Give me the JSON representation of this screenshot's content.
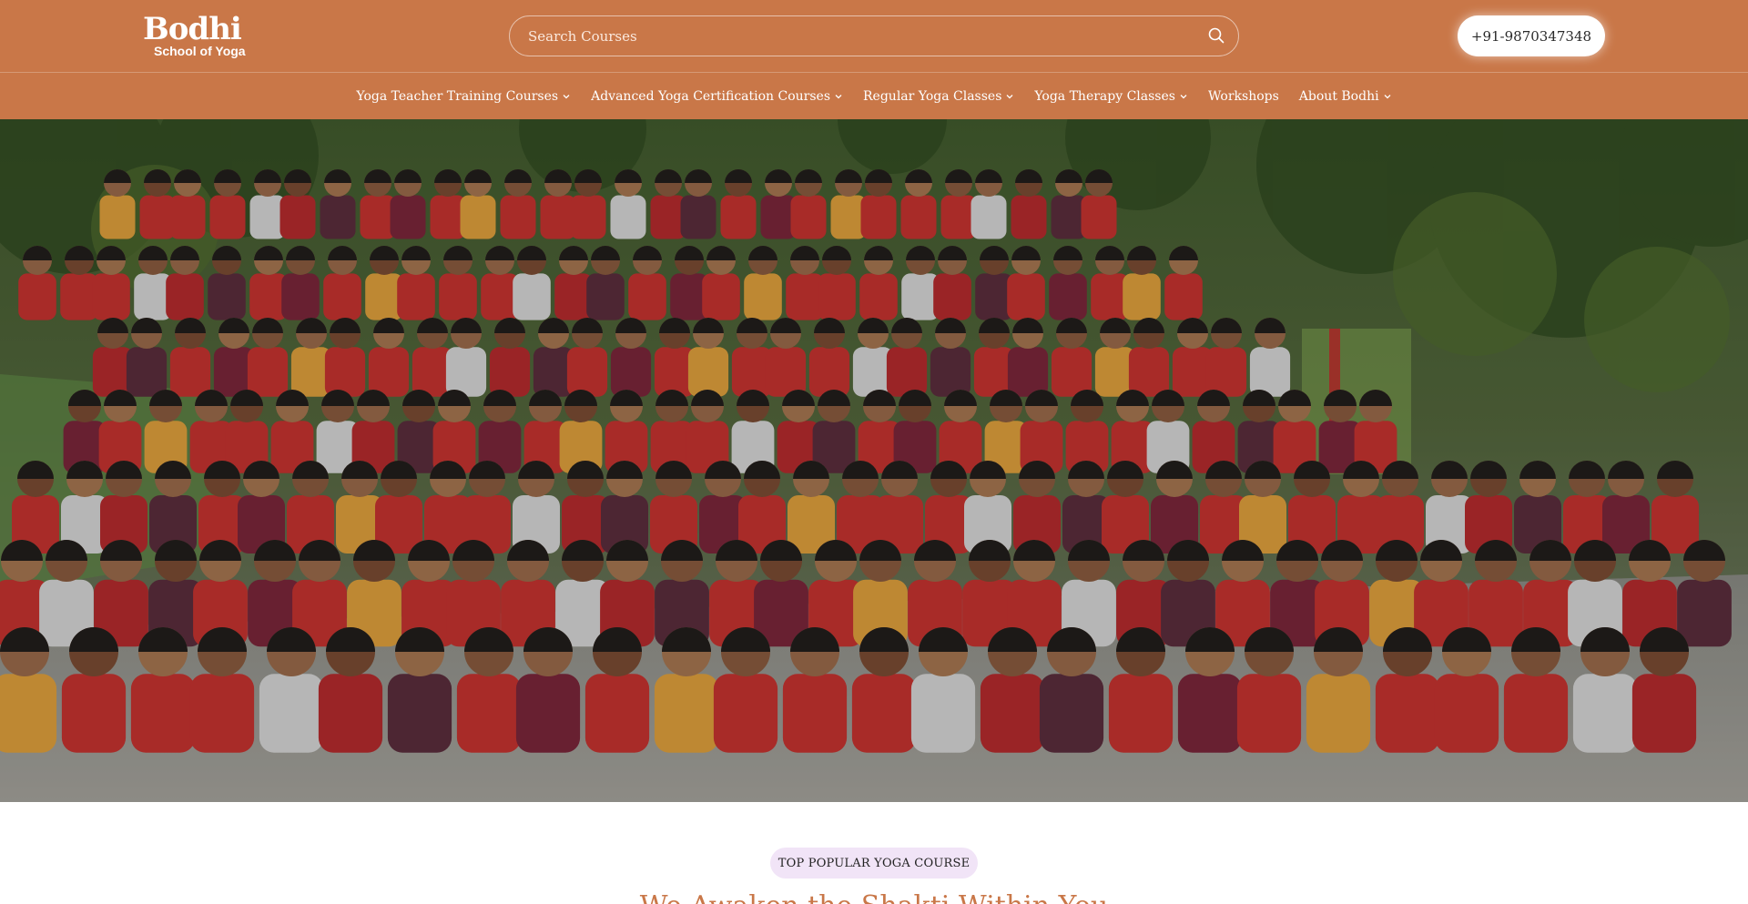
{
  "brand": {
    "logo_main": "Bodhi",
    "logo_sub": "School of Yoga",
    "header_color": "#c97748"
  },
  "search": {
    "placeholder": "Search Courses",
    "icon": "search-icon"
  },
  "phone": {
    "label": "+91-9870347348"
  },
  "nav": {
    "items": [
      {
        "label": "Yoga Teacher Training Courses",
        "dropdown": true
      },
      {
        "label": "Advanced Yoga Certification Courses",
        "dropdown": true
      },
      {
        "label": "Regular Yoga Classes",
        "dropdown": true
      },
      {
        "label": "Yoga Therapy Classes",
        "dropdown": true
      },
      {
        "label": "Workshops",
        "dropdown": false
      },
      {
        "label": "About Bodhi",
        "dropdown": true
      }
    ]
  },
  "hero": {
    "image": "group-photo"
  },
  "section": {
    "badge": "TOP POPULAR YOGA COURSE",
    "title": "We Awaken the Shakti Within You",
    "title_color": "#c97748",
    "badge_bg": "#f1e4f7"
  }
}
